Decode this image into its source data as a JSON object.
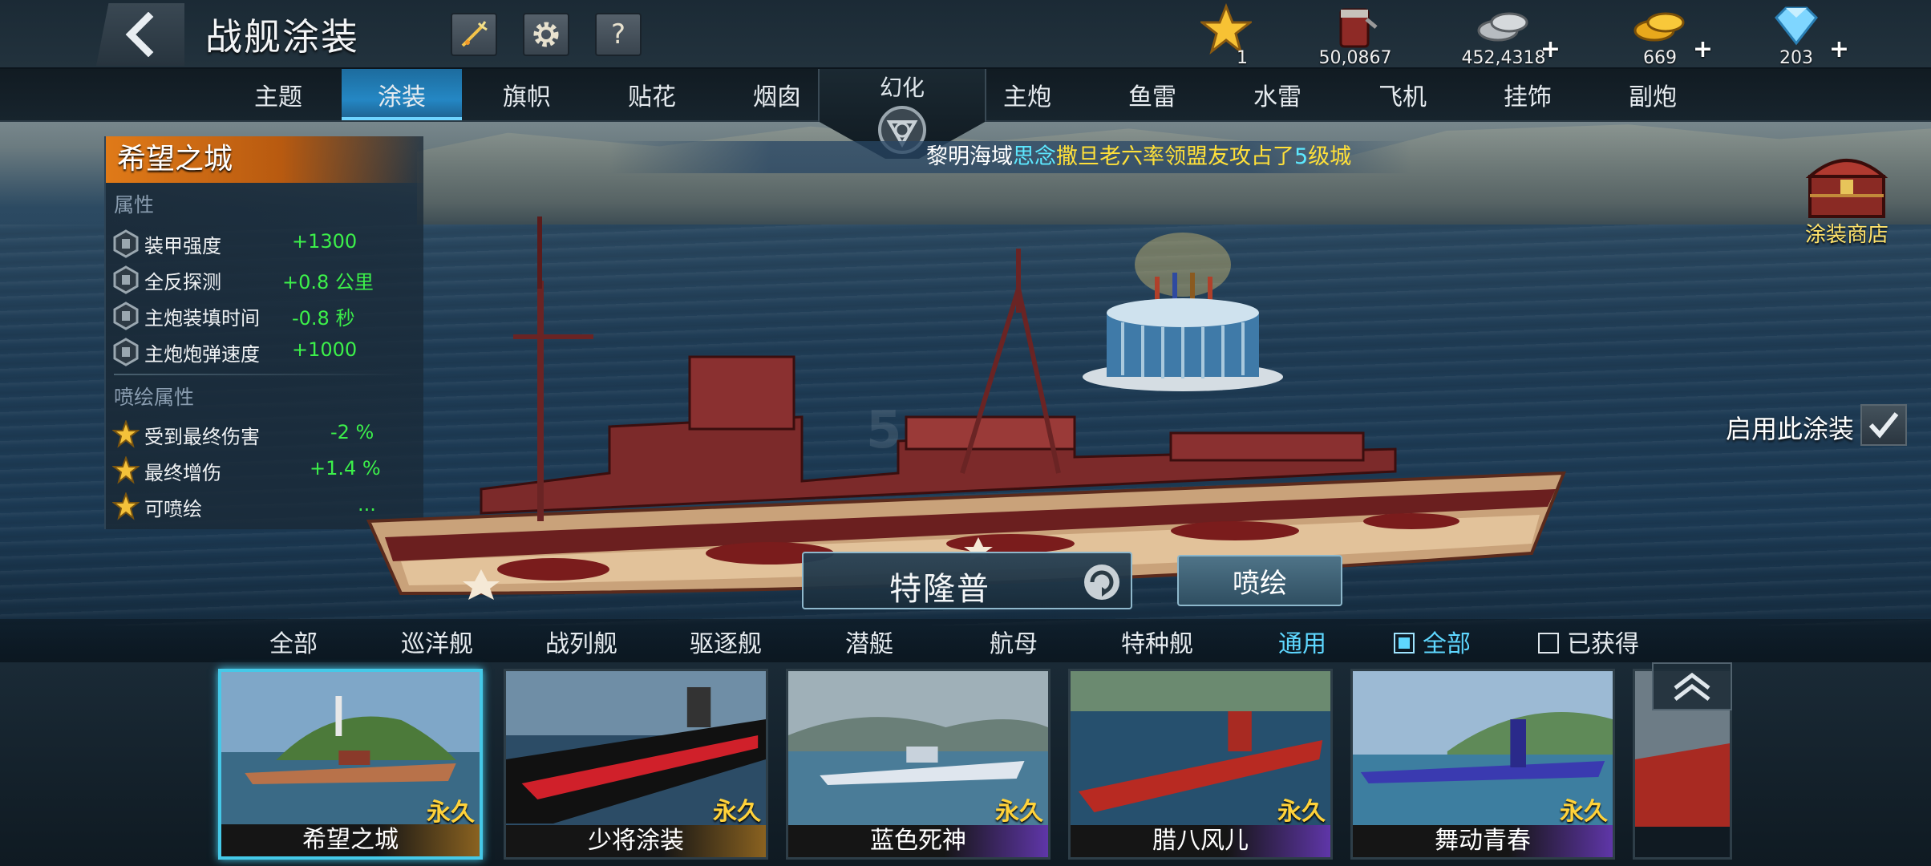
{
  "header": {
    "title": "战舰涂装",
    "icons": [
      "back-icon",
      "fireworks-icon",
      "gear-icon",
      "help-icon"
    ],
    "help_label": "?"
  },
  "currencies": [
    {
      "name": "star",
      "value": "1",
      "plus": ""
    },
    {
      "name": "paint-bucket",
      "value": "50,0867",
      "plus": ""
    },
    {
      "name": "silver-coins",
      "value": "452,4318",
      "plus": "+"
    },
    {
      "name": "gold-coins",
      "value": "669",
      "plus": "+"
    },
    {
      "name": "diamonds",
      "value": "203",
      "plus": "+"
    }
  ],
  "tabs": {
    "left": [
      "主题",
      "涂装",
      "旗帜",
      "贴花",
      "烟囱"
    ],
    "center": "幻化",
    "right": [
      "主炮",
      "鱼雷",
      "水雷",
      "飞机",
      "挂饰",
      "副炮"
    ],
    "active": "涂装"
  },
  "ticker": {
    "prefix": "黎明海域",
    "player": "思念",
    "middle": "撒旦老六率领盟友攻占了",
    "level": "5",
    "suffix": "级城"
  },
  "attributes": {
    "skin_name": "希望之城",
    "section_title": "属性",
    "items": [
      {
        "name": "装甲强度",
        "value": "+1300"
      },
      {
        "name": "全反探测",
        "value": "+0.8 公里"
      },
      {
        "name": "主炮装填时间",
        "value": "-0.8 秒"
      },
      {
        "name": "主炮炮弹速度",
        "value": "+1000"
      }
    ],
    "spray_section_title": "喷绘属性",
    "spray_items": [
      {
        "name": "受到最终伤害",
        "value": "-2 %"
      },
      {
        "name": "最终增伤",
        "value": "+1.4 %"
      },
      {
        "name": "可喷绘",
        "value": "..."
      }
    ]
  },
  "shop": {
    "label": "涂装商店"
  },
  "enable": {
    "label": "启用此涂装"
  },
  "ship": {
    "name": "特隆普",
    "spray_button": "喷绘"
  },
  "filters": {
    "types": [
      "全部",
      "巡洋舰",
      "战列舰",
      "驱逐舰",
      "潜艇",
      "航母",
      "特种舰",
      "通用"
    ],
    "active_type": "通用",
    "checks": [
      {
        "label": "全部",
        "checked": true
      },
      {
        "label": "已获得",
        "checked": false
      }
    ]
  },
  "skins": [
    {
      "name": "希望之城",
      "tag": "永久",
      "tier": "gold",
      "selected": true
    },
    {
      "name": "少将涂装",
      "tag": "永久",
      "tier": "gold",
      "selected": false
    },
    {
      "name": "蓝色死神",
      "tag": "永久",
      "tier": "purple",
      "selected": false
    },
    {
      "name": "腊八风儿",
      "tag": "永久",
      "tier": "purple",
      "selected": false
    },
    {
      "name": "舞动青春",
      "tag": "永久",
      "tier": "purple",
      "selected": false
    }
  ],
  "colors": {
    "accent_blue": "#2487c4",
    "attr_green": "#3cf04a",
    "orange_title": "#e07a18",
    "permanent_gold": "#ffd23a",
    "selected_border": "#45c9e8"
  }
}
